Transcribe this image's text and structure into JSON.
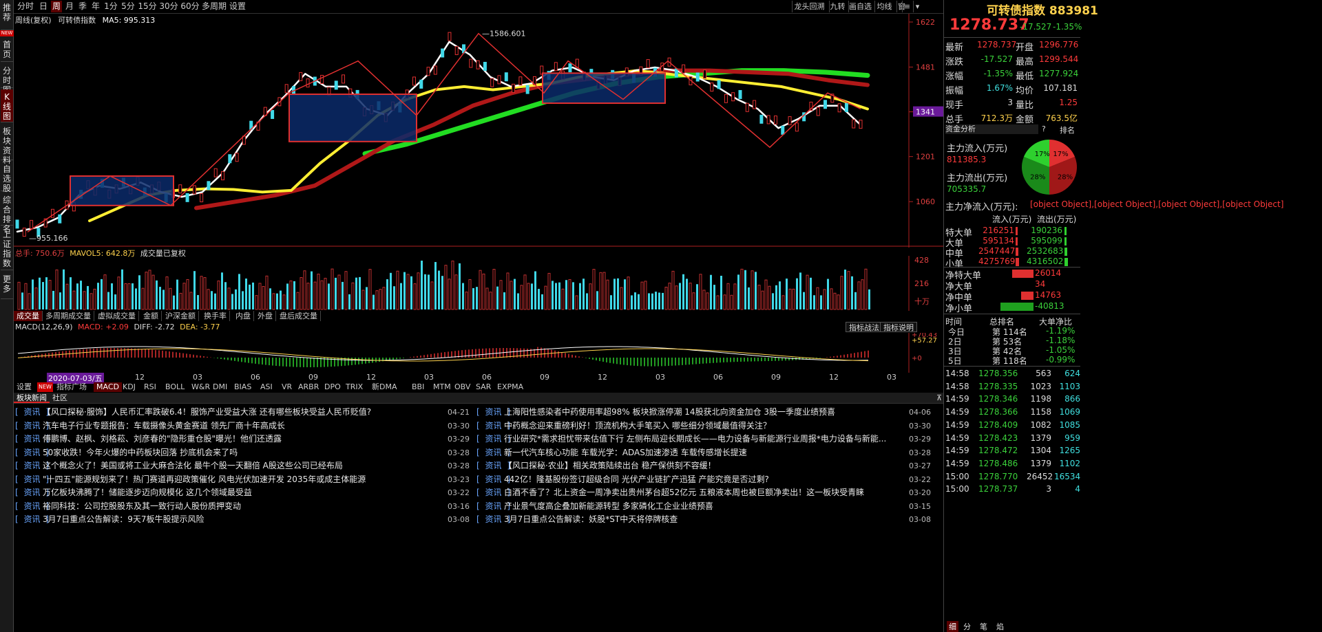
{
  "left_nav": [
    {
      "label": "推荐"
    },
    {
      "label": "首页"
    },
    {
      "label": "分时图"
    },
    {
      "label": "K线图"
    },
    {
      "label": "板块资料"
    },
    {
      "label": "自选股"
    },
    {
      "label": "综合排名"
    },
    {
      "label": "上证指数"
    },
    {
      "label": "更多"
    }
  ],
  "left_nav_new": "NEW",
  "period_tabs": [
    "分时",
    "日",
    "周",
    "月",
    "季",
    "年",
    "1分",
    "5分",
    "15分",
    "30分",
    "60分",
    "多周期",
    "设置"
  ],
  "active_period": "周",
  "toolbar_right": [
    "龙头回溯",
    "九转",
    "画自选",
    "均线",
    "窗"
  ],
  "chart": {
    "mode": "周线(复权)",
    "name": "可转债指数",
    "ma5_label": "MA5: 995.313",
    "high_label": "1586.601",
    "low_label": "955.166",
    "price_ticks": [
      "1622",
      "1481",
      "1341",
      "1201",
      "1060"
    ],
    "current_tag": "1341"
  },
  "volume": {
    "total": "总手: 750.6万",
    "mavol": "MAVOL5: 642.8万",
    "note": "成交量已复权",
    "ticks": [
      "428",
      "216",
      "十万"
    ]
  },
  "vol_tabs": [
    "成交量",
    "多周期成交量",
    "虚拟成交量",
    "金额",
    "沪深金额",
    "换手率",
    "内盘",
    "外盘",
    "盘后成交量"
  ],
  "macd": {
    "label": "MACD(12,26,9)",
    "macd": "MACD: +2.09",
    "diff": "DIFF: -2.72",
    "dea": "DEA: -3.77",
    "ticks": [
      "+70.43",
      "+57.27",
      "+0"
    ],
    "btn1": "指标战法",
    "btn2": "指标说明"
  },
  "date_axis": {
    "selected": "2020-07-03/五",
    "labels": [
      "12",
      "03",
      "06",
      "09",
      "12",
      "03",
      "06",
      "09",
      "12",
      "03",
      "06",
      "09",
      "12",
      "03",
      "06"
    ]
  },
  "indicator_tabs": [
    "设置",
    "NEW",
    "指标广场",
    "MACD",
    "KDJ",
    "RSI",
    "BOLL",
    "W&R",
    "DMI",
    "BIAS",
    "ASI",
    "VR",
    "ARBR",
    "DPO",
    "TRIX",
    "新DMA",
    "BBI",
    "MTM",
    "OBV",
    "SAR",
    "EXPMA"
  ],
  "news_tabs": [
    "板块新闻",
    "社区"
  ],
  "news_left": [
    {
      "tag": "资讯",
      "title": "【风口探秘·服饰】人民币汇率跌破6.4！服饰产业受益大涨 还有哪些板块受益人民币贬值?",
      "date": "04-21"
    },
    {
      "tag": "资讯",
      "title": "汽车电子行业专题报告：车载摄像头黄金赛道 领先厂商十年高成长",
      "date": "03-30"
    },
    {
      "tag": "资讯",
      "title": "傅鹏博、赵枫、刘格菘、刘彦春的\"隐形重仓股\"曝光！他们还透露",
      "date": "03-29"
    },
    {
      "tag": "资讯",
      "title": "50家收跌！今年火爆的中药板块回落 抄底机会来了吗",
      "date": "03-28"
    },
    {
      "tag": "资讯",
      "title": "这个概念火了！美国或将工业大麻合法化 最牛个股一天翻倍 A股这些公司已经布局",
      "date": "03-28"
    },
    {
      "tag": "资讯",
      "title": "\"十四五\"能源规划来了！热门赛道再迎政策催化 风电光伏加速开发 2035年或成主体能源",
      "date": "03-23"
    },
    {
      "tag": "资讯",
      "title": "万亿板块沸腾了！储能逐步迈向规模化 这几个领域最受益",
      "date": "03-22"
    },
    {
      "tag": "资讯",
      "title": "裕同科技：公司控股股东及其一致行动人股份质押变动",
      "date": "03-16"
    },
    {
      "tag": "资讯",
      "title": "3月7日重点公告解读：9天7板牛股提示风险",
      "date": "03-08"
    }
  ],
  "news_right": [
    {
      "tag": "资讯",
      "title": "上海阳性感染者中药使用率超98% 板块掀涨停潮 14股获北向资金加仓 3股一季度业绩预喜",
      "date": "04-06"
    },
    {
      "tag": "资讯",
      "title": "中药概念迎来重磅利好！顶流机构大手笔买入 哪些细分领域最值得关注？",
      "date": "03-30"
    },
    {
      "tag": "资讯",
      "title": "行业研究*需求担忧带来估值下行 左侧布局迎长期成长——电力设备与新能源行业周报*电力设备与新能...",
      "date": "03-29"
    },
    {
      "tag": "资讯",
      "title": "新一代汽车核心功能 车载光学：ADAS加速渗透 车载传感增长提速",
      "date": "03-28"
    },
    {
      "tag": "资讯",
      "title": "【风口探秘·农业】相关政策陆续出台 稳产保供刻不容缓！",
      "date": "03-27"
    },
    {
      "tag": "资讯",
      "title": "442亿！隆基股份签订超级合同 光伏产业链扩产迅猛 产能究竟是否过剩?",
      "date": "03-22"
    },
    {
      "tag": "资讯",
      "title": "白酒不香了？北上资金一周净卖出贵州茅台超52亿元 五粮液本周也被巨额净卖出！这一板块受青睐",
      "date": "03-20"
    },
    {
      "tag": "资讯",
      "title": "产业景气度高企叠加新能源转型 多家磷化工企业业绩预喜",
      "date": "03-15"
    },
    {
      "tag": "资讯",
      "title": "3月7日重点公告解读：妖股*ST中天将停牌核查",
      "date": "03-08"
    }
  ],
  "quote": {
    "name": "可转债指数",
    "code": "883981",
    "price": "1278.737",
    "change": "-17.527",
    "pct": "-1.35%",
    "rows": [
      {
        "l1": "最新",
        "v1": "1278.737",
        "c1": "red",
        "l2": "开盘",
        "v2": "1296.776",
        "c2": "red"
      },
      {
        "l1": "涨跌",
        "v1": "-17.527",
        "c1": "grn",
        "l2": "最高",
        "v2": "1299.544",
        "c2": "red"
      },
      {
        "l1": "涨幅",
        "v1": "-1.35%",
        "c1": "grn",
        "l2": "最低",
        "v2": "1277.924",
        "c2": "grn"
      },
      {
        "l1": "振幅",
        "v1": "1.67%",
        "c1": "cyan",
        "l2": "均价",
        "v2": "107.181",
        "c2": "wht"
      },
      {
        "l1": "现手",
        "v1": "3",
        "c1": "wht",
        "l2": "量比",
        "v2": "1.25",
        "c2": "red"
      },
      {
        "l1": "总手",
        "v1": "712.3万",
        "c1": "yel",
        "l2": "金额",
        "v2": "763.5亿",
        "c2": "yel"
      }
    ]
  },
  "capital": {
    "header": "资金分析",
    "help": "?",
    "rank": "排名",
    "inflow_label": "主力流入(万元)",
    "inflow": "811385.3",
    "outflow_label": "主力流出(万元)",
    "outflow": "705335.7",
    "net_label": "主力净流入(万元):",
    "net": [
      {
        "name": "净特大单",
        "value": "26014",
        "ratio": 0.65,
        "color": "#e03030"
      },
      {
        "name": "净大单",
        "value": "34",
        "ratio": 0.01,
        "color": "#e03030"
      },
      {
        "name": "净中单",
        "value": "14763",
        "ratio": 0.37,
        "color": "#e03030"
      },
      {
        "name": "净小单",
        "value": "-40813",
        "ratio": 1.0,
        "color": "#1fa01f"
      }
    ],
    "pie": [
      {
        "label": "17%",
        "value": 17,
        "color": "#e03030"
      },
      {
        "label": "28%",
        "value": 28,
        "color": "#a01818"
      },
      {
        "label": "28%",
        "value": 28,
        "color": "#1a8a1a"
      },
      {
        "label": "17%",
        "value": 17,
        "color": "#2ed02e"
      }
    ],
    "table_head": [
      "流入(万元)",
      "流出(万元)"
    ],
    "table": [
      {
        "name": "特大单",
        "in": "216251",
        "out": "190236",
        "in_ratio": 0.05,
        "out_ratio": 0.05
      },
      {
        "name": "大单",
        "in": "595134",
        "out": "595099",
        "in_ratio": 0.14,
        "out_ratio": 0.14
      },
      {
        "name": "中单",
        "in": "2547447",
        "out": "2532683",
        "in_ratio": 0.6,
        "out_ratio": 0.6
      },
      {
        "name": "小单",
        "in": "4275769",
        "out": "4316502",
        "in_ratio": 1.0,
        "out_ratio": 1.0
      }
    ]
  },
  "rank_table": {
    "head": [
      "时间",
      "总排名",
      "大单净比"
    ],
    "rows": [
      {
        "t": "今日",
        "r": "第 114名",
        "v": "-1.19%"
      },
      {
        "t": "2日",
        "r": "第 53名",
        "v": "-1.18%"
      },
      {
        "t": "3日",
        "r": "第 42名",
        "v": "-1.05%"
      },
      {
        "t": "5日",
        "r": "第 118名",
        "v": "-0.99%"
      }
    ]
  },
  "ticks": [
    {
      "time": "14:58",
      "price": "1278.356",
      "vol": "563",
      "amt": "624"
    },
    {
      "time": "14:58",
      "price": "1278.335",
      "vol": "1023",
      "amt": "1103"
    },
    {
      "time": "14:59",
      "price": "1278.346",
      "vol": "1198",
      "amt": "866"
    },
    {
      "time": "14:59",
      "price": "1278.366",
      "vol": "1158",
      "amt": "1069"
    },
    {
      "time": "14:59",
      "price": "1278.409",
      "vol": "1082",
      "amt": "1085"
    },
    {
      "time": "14:59",
      "price": "1278.423",
      "vol": "1379",
      "amt": "959"
    },
    {
      "time": "14:59",
      "price": "1278.472",
      "vol": "1304",
      "amt": "1265"
    },
    {
      "time": "14:59",
      "price": "1278.486",
      "vol": "1379",
      "amt": "1102"
    },
    {
      "time": "15:00",
      "price": "1278.770",
      "vol": "26452",
      "amt": "16534"
    },
    {
      "time": "15:00",
      "price": "1278.737",
      "vol": "3",
      "amt": "4"
    }
  ],
  "bottom_tabs": [
    "细",
    "分",
    "笔",
    "焰"
  ],
  "chart_data": {
    "type": "line",
    "x_labels": [
      "12",
      "03",
      "06",
      "09",
      "12",
      "03",
      "06",
      "09",
      "12",
      "03",
      "06",
      "09",
      "12",
      "03",
      "06"
    ],
    "ylim": [
      955,
      1622
    ],
    "series": [
      {
        "values": [
          966,
          980,
          1010,
          1080,
          1110,
          1100,
          1120,
          1090,
          1075,
          1090,
          1150,
          1250,
          1330,
          1390,
          1460,
          1420,
          1420,
          1350,
          1330,
          1400,
          1460,
          1560,
          1520,
          1450,
          1420,
          1430,
          1470,
          1480,
          1450,
          1440,
          1470,
          1480,
          1470,
          1450,
          1420,
          1380,
          1350,
          1290,
          1320,
          1360,
          1360,
          1300
        ]
      },
      {
        "values": [
          1000,
          1040,
          1080,
          1095,
          1100,
          1098,
          1090,
          1095,
          1180,
          1250,
          1330,
          1380,
          1410,
          1420,
          1410,
          1420,
          1430,
          1450,
          1460,
          1470,
          1460,
          1450,
          1440,
          1430,
          1420,
          1400,
          1380,
          1350
        ]
      },
      {
        "values": [
          1040,
          1060,
          1080,
          1110,
          1180,
          1250,
          1300,
          1360,
          1400,
          1430,
          1445,
          1460,
          1470,
          1470,
          1465,
          1460,
          1440,
          1425
        ]
      },
      {
        "values": [
          1210,
          1240,
          1280,
          1320,
          1360,
          1400,
          1430,
          1450,
          1460,
          1470,
          1470,
          1465,
          1455
        ]
      }
    ]
  }
}
